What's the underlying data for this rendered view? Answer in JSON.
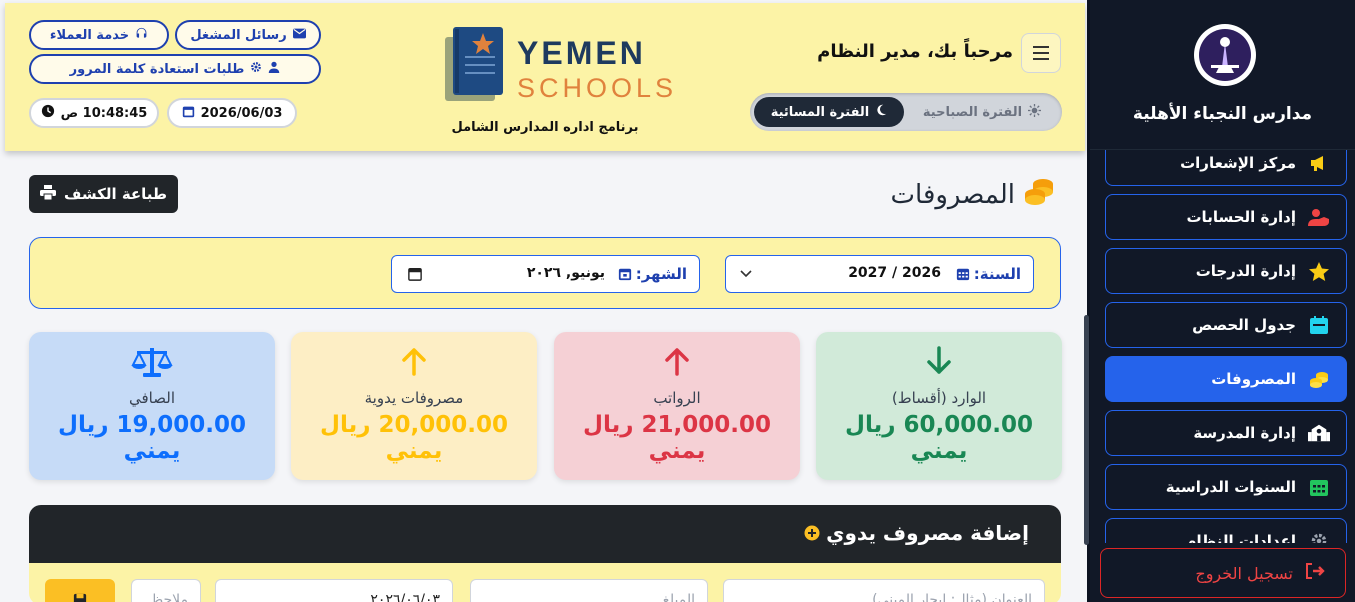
{
  "sidebar": {
    "school_name": "مدارس النجباء الأهلية",
    "items": [
      {
        "label": "مركز الإشعارات",
        "icon": "megaphone-icon",
        "color": "#facc15"
      },
      {
        "label": "إدارة الحسابات",
        "icon": "user-shield-icon",
        "color": "#ef4444"
      },
      {
        "label": "إدارة الدرجات",
        "icon": "star-icon",
        "color": "#facc15"
      },
      {
        "label": "جدول الحصص",
        "icon": "calendar-icon",
        "color": "#22d3ee"
      },
      {
        "label": "المصروفات",
        "icon": "coins-icon",
        "color": "#facc15",
        "active": true
      },
      {
        "label": "إدارة المدرسة",
        "icon": "school-icon",
        "color": "#ffffff"
      },
      {
        "label": "السنوات الدراسية",
        "icon": "calendar-grid-icon",
        "color": "#22c55e"
      },
      {
        "label": "إعدادات النظام",
        "icon": "gear-icon",
        "color": "#9ca3af"
      }
    ],
    "logout_label": "تسجيل الخروج"
  },
  "header": {
    "customer_service": "خدمة العملاء",
    "operator_messages": "رسائل المشغل",
    "password_requests": "طلبات استعادة كلمة المرور",
    "time": "10:48:45 ص",
    "date": "2026/06/03",
    "welcome": "مرحباً بك، مدير النظام",
    "shift_morning": "الفترة الصباحية",
    "shift_evening": "الفترة المسائية",
    "logo_line1": "YEMEN",
    "logo_line2": "SCHOOLS",
    "program_name": "برنامج اداره المدارس الشامل"
  },
  "page": {
    "title": "المصروفات",
    "print_button": "طباعة الكشف"
  },
  "filters": {
    "year_label": "السنة:",
    "year_value": "2026 / 2027",
    "month_label": "الشهر:",
    "month_value": "يونيو, ٢٠٢٦"
  },
  "cards": [
    {
      "label": "الوارد (أقساط)",
      "value": "60,000.00 ريال يمني",
      "icon": "arrow-down-icon",
      "color": "#198754"
    },
    {
      "label": "الرواتب",
      "value": "21,000.00 ريال يمني",
      "icon": "arrow-up-icon",
      "color": "#dc3545"
    },
    {
      "label": "مصروفات يدوية",
      "value": "20,000.00 ريال يمني",
      "icon": "arrow-up-icon",
      "color": "#ffc107"
    },
    {
      "label": "الصافي",
      "value": "19,000.00 ريال يمني",
      "icon": "scale-icon",
      "color": "#0d6efd"
    }
  ],
  "add_form": {
    "title": "إضافة مصروف يدوي",
    "title_placeholder": "العنوان (مثال: ايجار المبنى)",
    "amount_placeholder": "المبلغ",
    "date_value": "٢٠٢٦/٠٦/٠٣",
    "notes_placeholder": "ملاحظ"
  }
}
